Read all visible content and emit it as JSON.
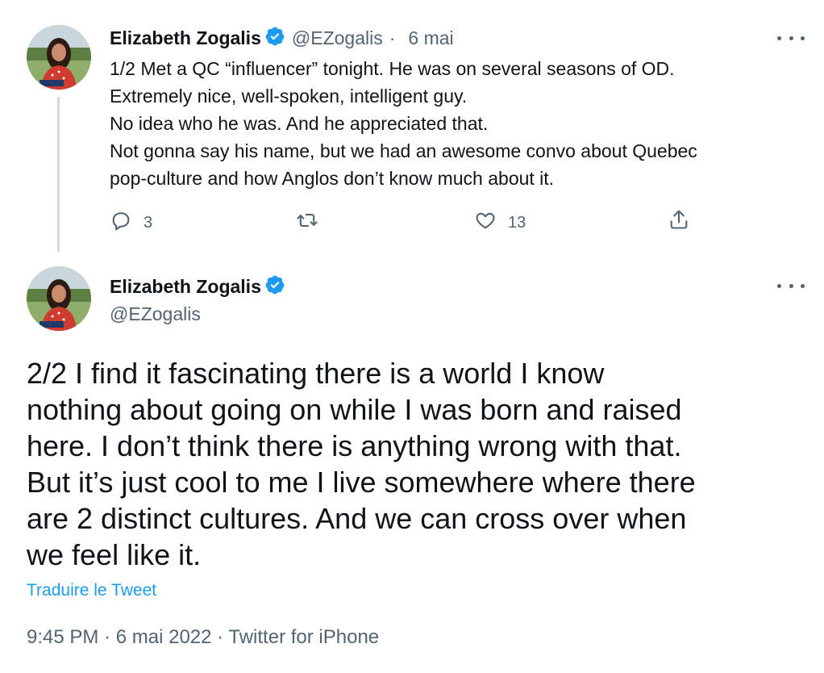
{
  "tweet1": {
    "author_name": "Elizabeth Zogalis",
    "handle": "@EZogalis",
    "separator": "·",
    "date": "6 mai",
    "lines": [
      "1/2 Met a QC “influencer” tonight. He was on several seasons of OD.",
      "Extremely nice, well-spoken, intelligent guy.",
      "No idea who he was. And he appreciated that.",
      "Not gonna say his name, but we had an awesome convo about Quebec",
      "pop-culture and how Anglos don’t know much about it."
    ],
    "actions": {
      "reply_icon": "reply-icon",
      "reply_count": "3",
      "retweet_icon": "retweet-icon",
      "like_icon": "heart-icon",
      "like_count": "13",
      "share_icon": "share-icon"
    }
  },
  "tweet2": {
    "author_name": "Elizabeth Zogalis",
    "handle": "@EZogalis",
    "lines": [
      "2/2  I find it fascinating there is a world I know",
      "nothing about going on while I was born and raised",
      "here.  I don’t think there is anything wrong with that.",
      "But it’s just cool to me I live somewhere where there",
      "are 2 distinct cultures. And we can cross over when",
      "we feel like it."
    ],
    "translate_link": "Traduire le Tweet",
    "time": "9:45 PM",
    "sep1": "·",
    "full_date": "6 mai 2022",
    "sep2": "·",
    "source": "Twitter for iPhone"
  },
  "colors": {
    "text": "#0f1419",
    "secondary": "#536471",
    "accent": "#1d9bf0",
    "verified": "#1d9bf0"
  }
}
